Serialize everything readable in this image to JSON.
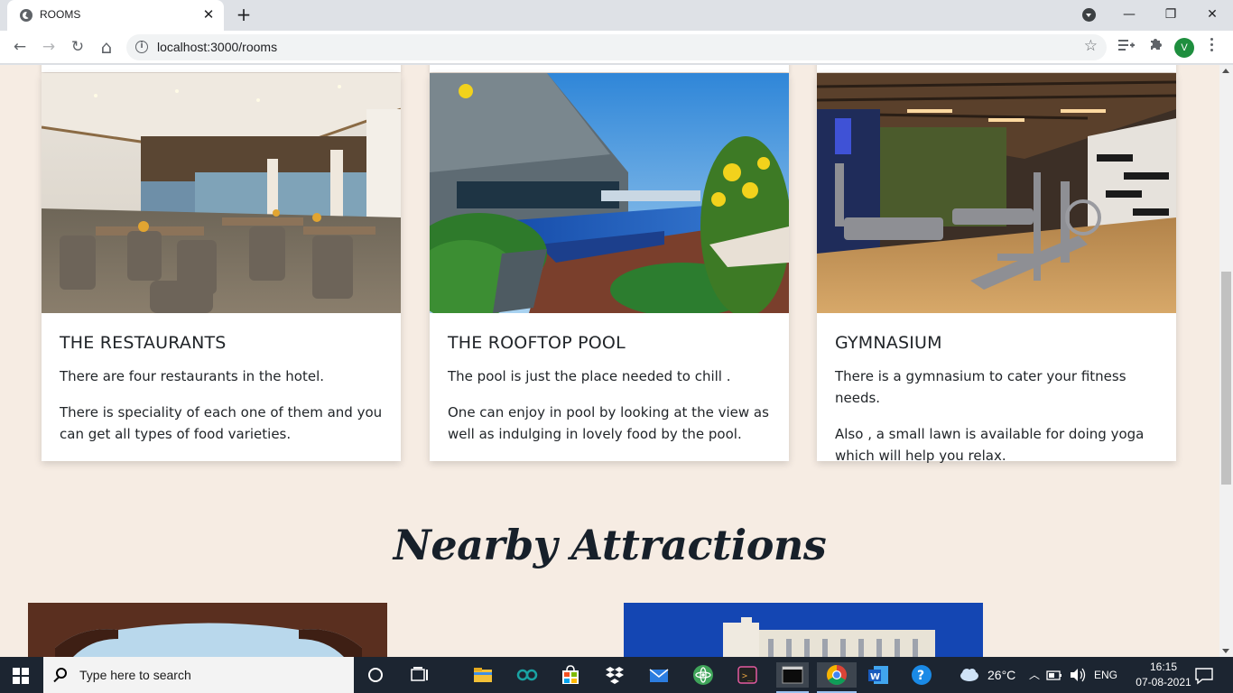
{
  "browser": {
    "tab_title": "ROOMS",
    "tab_close": "✕",
    "new_tab": "+",
    "url": "localhost:3000/rooms",
    "profile_initial": "V"
  },
  "window_controls": {
    "minimize": "—",
    "restore": "❐",
    "close": "✕"
  },
  "nav": {
    "back": "←",
    "forward": "→",
    "reload": "↻",
    "home": "⌂",
    "star": "☆",
    "info": "i"
  },
  "facilities": [
    {
      "title": "THE RESTAURANTS",
      "paragraphs": [
        "There are four restaurants in the hotel.",
        "There is speciality of each one of them and you can get all types of food varieties."
      ]
    },
    {
      "title": "THE ROOFTOP POOL",
      "paragraphs": [
        "The pool is just the place needed to chill .",
        "One can enjoy in pool by looking at the view as well as indulging in lovely food by the pool."
      ]
    },
    {
      "title": "GYMNASIUM",
      "paragraphs": [
        "There is a gymnasium to cater your fitness needs.",
        "Also , a small lawn is available for doing yoga which will help you relax."
      ]
    }
  ],
  "attractions": {
    "heading": "Nearby Attractions"
  },
  "taskbar": {
    "search_placeholder": "Type here to search",
    "weather": "26°C",
    "language": "ENG",
    "time": "16:15",
    "date": "07-08-2021"
  },
  "colors": {
    "page_bg": "#f6ece3",
    "heading": "#17202a",
    "text": "#212529",
    "taskbar": "#1c2531"
  }
}
